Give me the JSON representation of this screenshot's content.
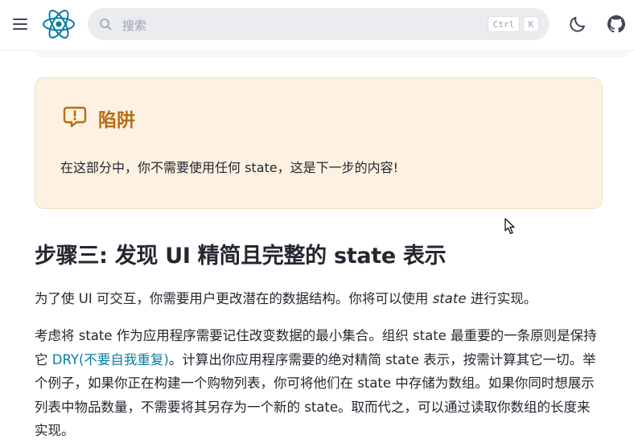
{
  "header": {
    "search_placeholder": "搜索",
    "shortcut_ctrl": "Ctrl",
    "shortcut_k": "K"
  },
  "callout": {
    "title": "陷阱",
    "body": "在这部分中，你不需要使用任何 state，这是下一步的内容!"
  },
  "section": {
    "heading": "步骤三: 发现 UI 精简且完整的 state 表示",
    "p1_before": "为了使 UI 可交互，你需要用户更改潜在的数据结构。你将可以使用 ",
    "p1_em": "state",
    "p1_after": " 进行实现。",
    "p2_before": "考虑将 state 作为应用程序需要记住改变数据的最小集合。组织 state 最重要的一条原则是保持它 ",
    "p2_link": "DRY(不要自我重复)",
    "p2_after": "。计算出你应用程序需要的绝对精简 state 表示，按需计算其它一切。举个例子，如果你正在构建一个购物列表，你可将他们在 state 中存储为数组。如果你同时想展示列表中物品数量，不需要将其另存为一个新的 state。取而代之，可以通过读取你数组的长度来实现。"
  },
  "colors": {
    "accent": "#087ea4",
    "callout_bg": "#fdf1e1",
    "callout_title": "#b86c13"
  },
  "icons": [
    "menu-icon",
    "react-logo-icon",
    "search-icon",
    "moon-icon",
    "github-icon",
    "pitfall-icon",
    "mouse-cursor-icon"
  ]
}
